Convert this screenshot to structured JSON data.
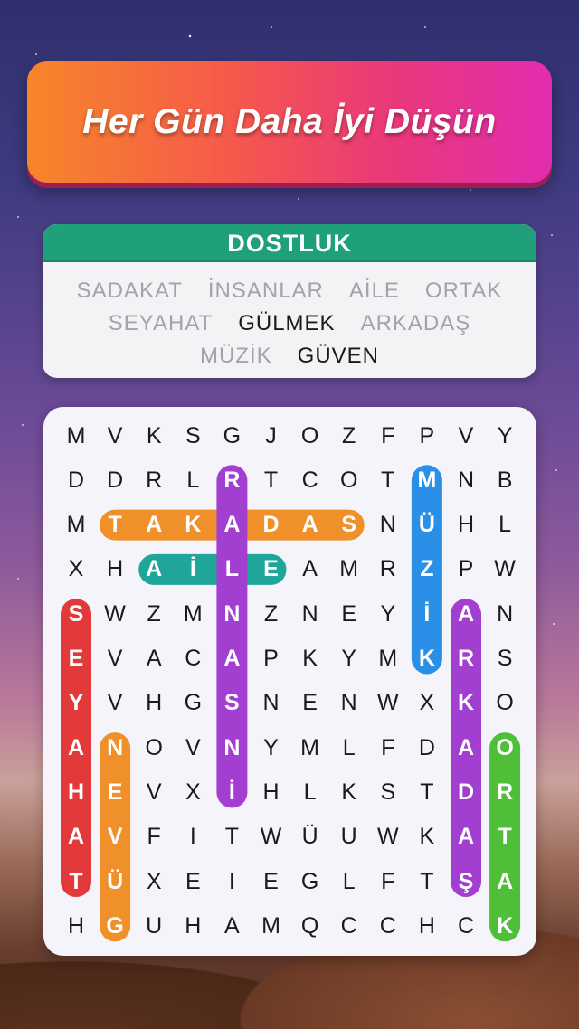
{
  "banner": {
    "title": "Her Gün Daha İyi Düşün"
  },
  "category": {
    "title": "DOSTLUK"
  },
  "word_list": [
    [
      {
        "text": "SADAKAT",
        "found": true
      },
      {
        "text": "İNSANLAR",
        "found": true
      },
      {
        "text": "AİLE",
        "found": true
      },
      {
        "text": "ORTAK",
        "found": true
      }
    ],
    [
      {
        "text": "SEYAHAT",
        "found": true
      },
      {
        "text": "GÜLMEK",
        "found": false
      },
      {
        "text": "ARKADAŞ",
        "found": true
      }
    ],
    [
      {
        "text": "MÜZİK",
        "found": true
      },
      {
        "text": "GÜVEN",
        "found": false
      }
    ]
  ],
  "grid": [
    [
      "M",
      "V",
      "K",
      "S",
      "G",
      "J",
      "O",
      "Z",
      "F",
      "P",
      "V",
      "Y"
    ],
    [
      "D",
      "D",
      "R",
      "L",
      "R",
      "T",
      "C",
      "O",
      "T",
      "M",
      "N",
      "B"
    ],
    [
      "M",
      "T",
      "A",
      "K",
      "A",
      "D",
      "A",
      "S",
      "N",
      "Ü",
      "H",
      "L"
    ],
    [
      "X",
      "H",
      "A",
      "İ",
      "L",
      "E",
      "A",
      "M",
      "R",
      "Z",
      "P",
      "W"
    ],
    [
      "S",
      "W",
      "Z",
      "M",
      "N",
      "Z",
      "N",
      "E",
      "Y",
      "İ",
      "A",
      "N"
    ],
    [
      "E",
      "V",
      "A",
      "C",
      "A",
      "P",
      "K",
      "Y",
      "M",
      "K",
      "R",
      "S"
    ],
    [
      "Y",
      "V",
      "H",
      "G",
      "S",
      "N",
      "E",
      "N",
      "W",
      "X",
      "K",
      "O"
    ],
    [
      "A",
      "N",
      "O",
      "V",
      "N",
      "Y",
      "M",
      "L",
      "F",
      "D",
      "A",
      "O"
    ],
    [
      "H",
      "E",
      "V",
      "X",
      "İ",
      "H",
      "L",
      "K",
      "S",
      "T",
      "D",
      "R"
    ],
    [
      "A",
      "V",
      "F",
      "I",
      "T",
      "W",
      "Ü",
      "U",
      "W",
      "K",
      "A",
      "T"
    ],
    [
      "T",
      "Ü",
      "X",
      "E",
      "I",
      "E",
      "G",
      "L",
      "F",
      "T",
      "Ş",
      "A"
    ],
    [
      "H",
      "G",
      "U",
      "H",
      "A",
      "M",
      "Q",
      "C",
      "C",
      "H",
      "C",
      "K"
    ]
  ],
  "found_words": [
    {
      "word": "SADAKAT",
      "color": "#f0902a",
      "start": [
        2,
        1
      ],
      "end": [
        2,
        7
      ]
    },
    {
      "word": "AİLE",
      "color": "#1fa59a",
      "start": [
        3,
        2
      ],
      "end": [
        3,
        5
      ]
    },
    {
      "word": "İNSANLAR",
      "color": "#a23fd0",
      "start": [
        1,
        4
      ],
      "end": [
        8,
        4
      ]
    },
    {
      "word": "MÜZİK",
      "color": "#2a8fe6",
      "start": [
        1,
        9
      ],
      "end": [
        5,
        9
      ]
    },
    {
      "word": "SEYAHAT",
      "color": "#e23a3a",
      "start": [
        4,
        0
      ],
      "end": [
        10,
        0
      ]
    },
    {
      "word": "ARKADAŞ",
      "color": "#a23fd0",
      "start": [
        4,
        10
      ],
      "end": [
        10,
        10
      ]
    },
    {
      "word": "GÜVEN",
      "color": "#f0902a",
      "start": [
        7,
        1
      ],
      "end": [
        11,
        1
      ]
    },
    {
      "word": "ORTAK",
      "color": "#4fbf3a",
      "start": [
        7,
        11
      ],
      "end": [
        11,
        11
      ]
    }
  ]
}
